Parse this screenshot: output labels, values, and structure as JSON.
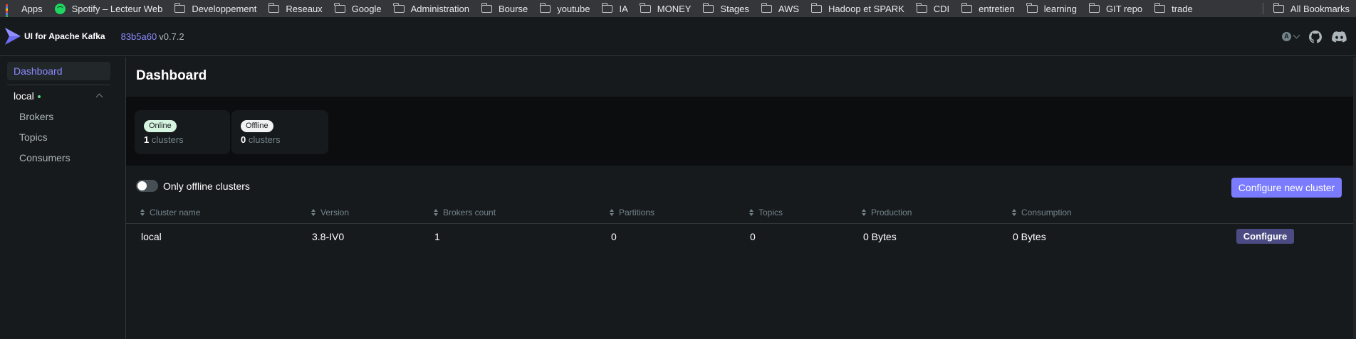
{
  "bookmarks": {
    "items": [
      {
        "label": "Apps",
        "icon": "apps-grid-icon"
      },
      {
        "label": "Spotify – Lecteur Web",
        "icon": "spotify-icon"
      },
      {
        "label": "Developpement",
        "icon": "folder-icon"
      },
      {
        "label": "Reseaux",
        "icon": "folder-icon"
      },
      {
        "label": "Google",
        "icon": "folder-icon"
      },
      {
        "label": "Administration",
        "icon": "folder-icon"
      },
      {
        "label": "Bourse",
        "icon": "folder-icon"
      },
      {
        "label": "youtube",
        "icon": "folder-icon"
      },
      {
        "label": "IA",
        "icon": "folder-icon"
      },
      {
        "label": "MONEY",
        "icon": "folder-icon"
      },
      {
        "label": "Stages",
        "icon": "folder-icon"
      },
      {
        "label": "AWS",
        "icon": "folder-icon"
      },
      {
        "label": "Hadoop et SPARK",
        "icon": "folder-icon"
      },
      {
        "label": "CDI",
        "icon": "folder-icon"
      },
      {
        "label": "entretien",
        "icon": "folder-icon"
      },
      {
        "label": "learning",
        "icon": "folder-icon"
      },
      {
        "label": "GIT repo",
        "icon": "folder-icon"
      },
      {
        "label": "trade",
        "icon": "folder-icon"
      }
    ],
    "all_bookmarks": "All Bookmarks"
  },
  "header": {
    "brand": "UI for Apache Kafka",
    "commit": "83b5a60",
    "version": "v0.7.2",
    "theme_icon_letter": "A"
  },
  "sidebar": {
    "dashboard": "Dashboard",
    "cluster": "local",
    "items": [
      "Brokers",
      "Topics",
      "Consumers"
    ]
  },
  "main": {
    "title": "Dashboard",
    "online": {
      "badge": "Online",
      "count": "1",
      "unit": "clusters"
    },
    "offline": {
      "badge": "Offline",
      "count": "0",
      "unit": "clusters"
    },
    "toggle_label": "Only offline clusters",
    "configure_new": "Configure new cluster",
    "columns": [
      "Cluster name",
      "Version",
      "Brokers count",
      "Partitions",
      "Topics",
      "Production",
      "Consumption"
    ],
    "rows": [
      {
        "name": "local",
        "version": "3.8-IV0",
        "brokers": "1",
        "partitions": "0",
        "topics": "0",
        "production": "0 Bytes",
        "consumption": "0 Bytes",
        "action": "Configure"
      }
    ]
  },
  "colors": {
    "accent": "#7B7BFF",
    "online_dot": "#5CD685",
    "background": "#171A1C"
  }
}
